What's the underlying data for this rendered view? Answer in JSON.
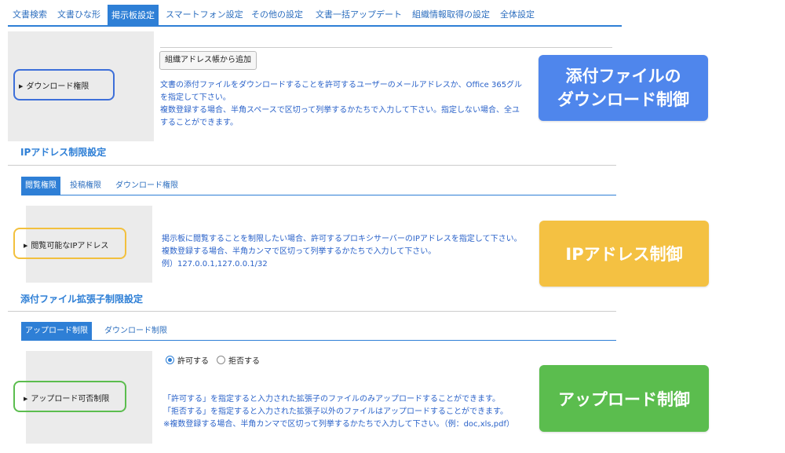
{
  "colors": {
    "accent": "#2e7fd6",
    "callout_blue": "#4f86ec",
    "callout_yellow": "#f4c142",
    "callout_green": "#5bbd4e"
  },
  "main_tabs": [
    {
      "label": "文書検索",
      "active": false
    },
    {
      "label": "文書ひな形",
      "active": false
    },
    {
      "label": "掲示板設定",
      "active": true
    },
    {
      "label": "スマートフォン設定",
      "active": false
    },
    {
      "label": "その他の設定",
      "active": false
    },
    {
      "label": "文書一括アップデート",
      "active": false
    },
    {
      "label": "組織情報取得の設定",
      "active": false
    },
    {
      "label": "全体設定",
      "active": false
    }
  ],
  "download_section": {
    "row_label": "ダウンロード権限",
    "address_book_button": "組織アドレス帳から追加",
    "desc_lines": [
      "文書の添付ファイルをダウンロードすることを許可するユーザーのメールアドレスか、Office 365グル",
      "を指定して下さい。",
      "複数登録する場合、半角スペースで区切って列挙するかたちで入力して下さい。指定しない場合、全ユ",
      "することができます。"
    ]
  },
  "ip_section": {
    "title": "IPアドレス制限設定",
    "subtabs": [
      {
        "label": "閲覧権限",
        "active": true
      },
      {
        "label": "投稿権限",
        "active": false
      },
      {
        "label": "ダウンロード権限",
        "active": false
      }
    ],
    "row_label": "閲覧可能なIPアドレス",
    "desc_lines": [
      "掲示板に閲覧することを制限したい場合、許可するプロキシサーバーのIPアドレスを指定して下さい。",
      "複数登録する場合、半角カンマで区切って列挙するかたちで入力して下さい。",
      "例）127.0.0.1,127.0.0.1/32"
    ]
  },
  "ext_section": {
    "title": "添付ファイル拡張子制限設定",
    "subtabs": [
      {
        "label": "アップロード制限",
        "active": true
      },
      {
        "label": "ダウンロード制限",
        "active": false
      }
    ],
    "row_label": "アップロード可否制限",
    "radio_options": [
      {
        "label": "許可する",
        "checked": true
      },
      {
        "label": "拒否する",
        "checked": false
      }
    ],
    "desc_lines": [
      "「許可する」を指定すると入力された拡張子のファイルのみアップロードすることができます。",
      "「拒否する」を指定すると入力された拡張子以外のファイルはアップロードすることができます。",
      "※複数登録する場合、半角カンマで区切って列挙するかたちで入力して下さい。（例：doc,xls,pdf）"
    ]
  },
  "callouts": {
    "download": {
      "line1": "添付ファイルの",
      "line2": "ダウンロード制御"
    },
    "ip": {
      "line1": "IPアドレス制御"
    },
    "upload": {
      "line1": "アップロード制御"
    }
  }
}
